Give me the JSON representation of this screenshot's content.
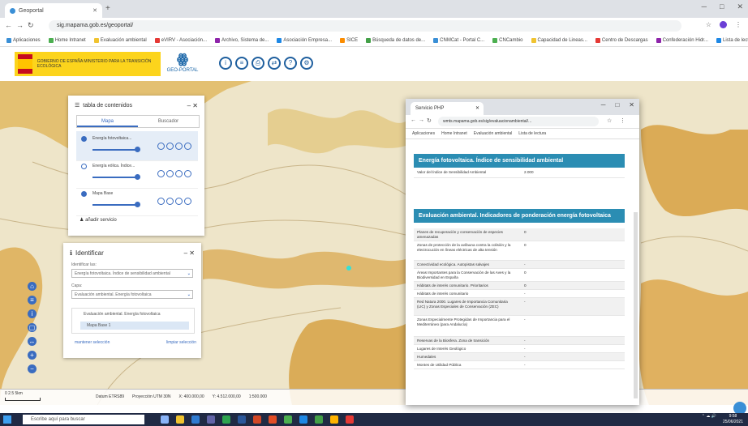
{
  "browser": {
    "tab_title": "Geoportal",
    "url": "sig.mapama.gob.es/geoportal/",
    "bookmarks": [
      "Aplicaciones",
      "Home Intranet",
      "Evaluación ambiental",
      "eVIRV - Asociación...",
      "Archivo, Sistema de...",
      "Asociación Empresa...",
      "SICE",
      "Búsqueda de datos de...",
      "CNMCat - Portal C...",
      "CNCambio",
      "Capacidad de Lineas...",
      "Centro de Descargas",
      "Confederación Hidr...",
      "Lista de lectura"
    ]
  },
  "header": {
    "gov_text": "GOBIERNO DE ESPAÑA  MINISTERIO PARA LA TRANSICIÓN ECOLÓGICA",
    "portal_name": "GEO-PORTAL",
    "tool_icons": [
      "info-icon",
      "layers-icon",
      "print-icon",
      "share-icon",
      "help-icon",
      "settings-icon"
    ]
  },
  "toc": {
    "title": "tabla de contenidos",
    "tab_active": "Mapa",
    "tab_inactive": "Buscador",
    "layers": [
      {
        "name": "Energía fotovoltaica...",
        "selected": true
      },
      {
        "name": "Energía eólica. Índice...",
        "selected": false
      },
      {
        "name": "Mapa Base",
        "selected": false
      }
    ],
    "add_service": "añadir servicio"
  },
  "identify": {
    "title": "Identificar",
    "label_layer": "Identificar las:",
    "select_layer": "Energía fotovoltaica. Índice de sensibilidad ambiental",
    "label_value": "Capa:",
    "select_value": "Evaluación ambiental. Energía fotovoltaica",
    "tree_parent": "Evaluación ambiental. Energía fotovoltaica",
    "tree_child": "Mapa Base 1",
    "keep_selection": "mantener selección",
    "clear_selection": "limpiar selección"
  },
  "maptools": [
    "home-icon",
    "layers-icon",
    "info-icon",
    "zoom-box-icon",
    "measure-icon",
    "zoom-in-icon",
    "zoom-out-icon"
  ],
  "mapfoot": {
    "scale_label": "0     2.5     5km",
    "datum": "Datum ETRS89",
    "projection": "Proyección UTM 30N",
    "x": "X: 400.000,00",
    "y": "Y: 4.512.000,00",
    "zoom": "1:500.000"
  },
  "popup": {
    "tab_title": "Servicio PHP",
    "url": "wmts.mapama.gob.es/sig/evaluacionambiental/...",
    "bookmarks": [
      "Aplicaciones",
      "Home Intranet",
      "Evaluación ambiental",
      "Lista de lectura"
    ],
    "section1_title": "Energía fotovoltaica. Índice de sensibilidad ambiental",
    "section1_row_label": "Valor del Índice de Sensibilidad Ambiental",
    "section1_row_value": "2.000",
    "section2_title": "Evaluación ambiental. Indicadores de ponderación energía fotovoltaica",
    "section2_rows": [
      {
        "label": "Planes de recuperación y conservación de especies amenazadas",
        "value": "0"
      },
      {
        "label": "Zonas de protección de la avifauna contra la colisión y la electrocución en líneas eléctricas de alta tensión",
        "value": "0"
      },
      {
        "label": "Conectividad ecológica. Autopistas salvajes",
        "value": "-"
      },
      {
        "label": "Áreas Importantes para la Conservación de las Aves y la Biodiversidad en España",
        "value": "0"
      },
      {
        "label": "Hábitats de interés comunitario. Prioritarios",
        "value": "0"
      },
      {
        "label": "Hábitats de interés comunitario",
        "value": "-"
      },
      {
        "label": "Red Natura 2000. Lugares de Importancia Comunitaria (LIC) y Zonas Especiales de Conservación (ZEC)",
        "value": "-"
      },
      {
        "label": "Zonas Especialmente Protegidas de Importancia para el Mediterráneo (para Andalucía)",
        "value": "-"
      },
      {
        "label": "Reservas de la Biosfera. Zona de transición",
        "value": "-"
      },
      {
        "label": "Lugares de Interés Geológico",
        "value": "-"
      },
      {
        "label": "Humedales",
        "value": "-"
      },
      {
        "label": "Montes de Utilidad Pública",
        "value": "-"
      }
    ]
  },
  "taskbar": {
    "search_placeholder": "Escribe aquí para buscar",
    "time": "9:58",
    "date": "25/06/2021"
  }
}
